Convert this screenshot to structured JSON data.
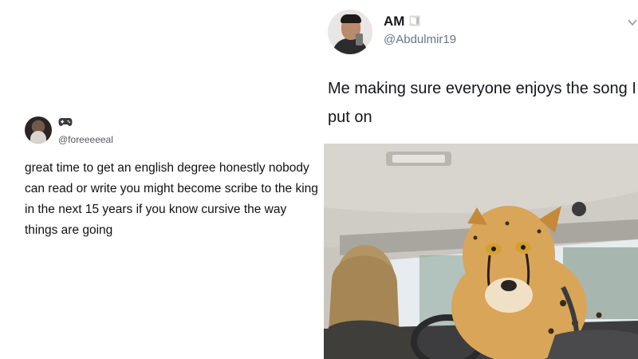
{
  "left_tweet": {
    "badge_icon": "game-controller-icon",
    "handle": "@foreeeeeal",
    "text": "great time to get an english degree honestly nobody can read or write you might become scribe to the king in the next 15 years if you know cursive the way things are going"
  },
  "right_tweet": {
    "name": "AM",
    "flag_icon": "flag-icon",
    "handle": "@Abdulmir19",
    "text": "Me making sure everyone enjoys the song I put on",
    "more_icon": "chevron-down-icon",
    "photo_subject": "cheetah-in-car-image"
  }
}
